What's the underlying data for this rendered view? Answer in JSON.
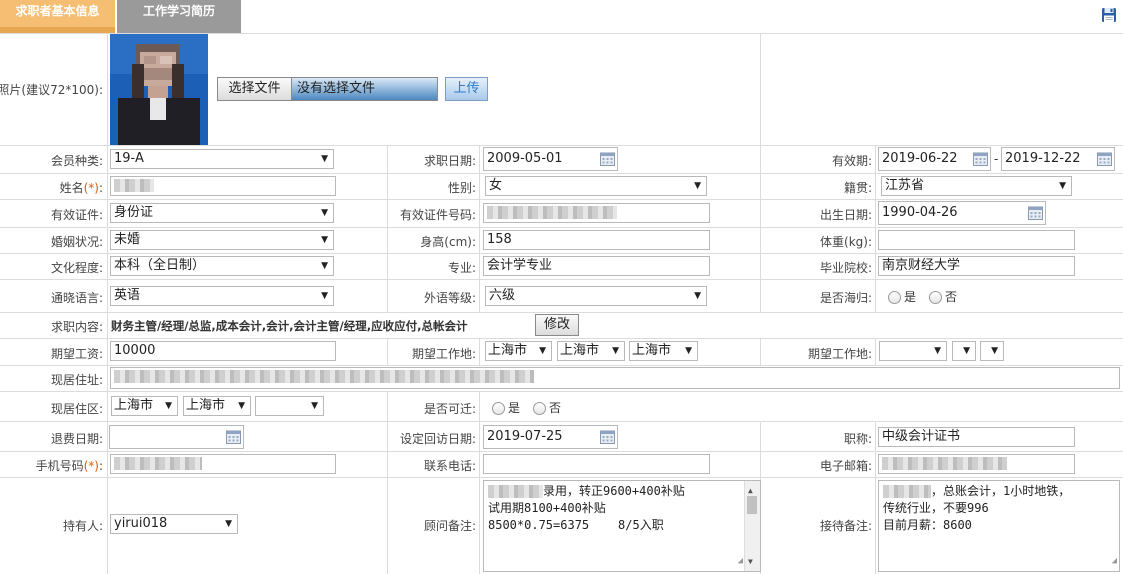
{
  "tabs": [
    {
      "label": "求职者基本信息"
    },
    {
      "label": "工作学习简历"
    }
  ],
  "photo": {
    "label": "照片(建议72*100):",
    "choose_file_label": "选择文件",
    "no_file_label": "没有选择文件",
    "upload_label": "上传"
  },
  "fields": {
    "member_type": {
      "label": "会员种类:",
      "value": "19-A"
    },
    "apply_date": {
      "label": "求职日期:",
      "value": "2009-05-01"
    },
    "valid_period": {
      "label": "有效期:",
      "start": "2019-06-22",
      "sep": "-",
      "end": "2019-12-22"
    },
    "name": {
      "label": "姓名",
      "star": "(*)",
      "colon": ":"
    },
    "gender": {
      "label": "性别:",
      "value": "女"
    },
    "native_place": {
      "label": "籍贯:",
      "value": "江苏省"
    },
    "id_type": {
      "label": "有效证件:",
      "value": "身份证"
    },
    "id_number": {
      "label": "有效证件号码:"
    },
    "birth_date": {
      "label": "出生日期:",
      "value": "1990-04-26"
    },
    "marital": {
      "label": "婚姻状况:",
      "value": "未婚"
    },
    "height": {
      "label": "身高(cm):",
      "value": "158"
    },
    "weight": {
      "label": "体重(kg):",
      "value": ""
    },
    "education": {
      "label": "文化程度:",
      "value": "本科（全日制）"
    },
    "major": {
      "label": "专业:",
      "value": "会计学专业"
    },
    "school": {
      "label": "毕业院校:",
      "value": "南京财经大学"
    },
    "language": {
      "label": "通晓语言:",
      "value": "英语"
    },
    "language_level": {
      "label": "外语等级:",
      "value": "六级"
    },
    "overseas": {
      "label": "是否海归:",
      "yes": "是",
      "no": "否"
    },
    "job_content": {
      "label": "求职内容:",
      "value": "财务主管/经理/总监,成本会计,会计,会计主管/经理,应收应付,总帐会计",
      "edit_label": "修改"
    },
    "salary": {
      "label": "期望工资:",
      "value": "10000"
    },
    "work_place1": {
      "label": "期望工作地:",
      "v1": "上海市",
      "v2": "上海市",
      "v3": "上海市"
    },
    "work_place2": {
      "label": "期望工作地:",
      "v1": "",
      "v2": "",
      "v3": ""
    },
    "address": {
      "label": "现居住址:"
    },
    "district": {
      "label": "现居住区:",
      "v1": "上海市",
      "v2": "上海市",
      "v3": ""
    },
    "relocate": {
      "label": "是否可迁:",
      "yes": "是",
      "no": "否"
    },
    "refund_date": {
      "label": "退费日期:",
      "value": ""
    },
    "revisit_date": {
      "label": "设定回访日期:",
      "value": "2019-07-25"
    },
    "title": {
      "label": "职称:",
      "value": "中级会计证书"
    },
    "mobile": {
      "label": "手机号码",
      "star": "(*)",
      "colon": ":"
    },
    "phone": {
      "label": "联系电话:",
      "value": ""
    },
    "email": {
      "label": "电子邮箱:"
    },
    "owner": {
      "label": "持有人:",
      "value": "yirui018"
    },
    "advisor_note": {
      "label": "顾问备注:",
      "line1": "录用，转正9600+400补贴",
      "line2": "试用期8100+400补贴",
      "line3": "8500*0.75=6375    8/5入职"
    },
    "reception_note": {
      "label": "接待备注:",
      "line1": "，总账会计，1小时地铁，",
      "line2": "传统行业，不要996",
      "line3": "目前月薪：8600"
    }
  },
  "colors": {
    "tab_active": "#f6be73",
    "tab_inactive": "#9a9a9a",
    "required_star": "#e05a00",
    "upload_button": "#2f79c6"
  }
}
